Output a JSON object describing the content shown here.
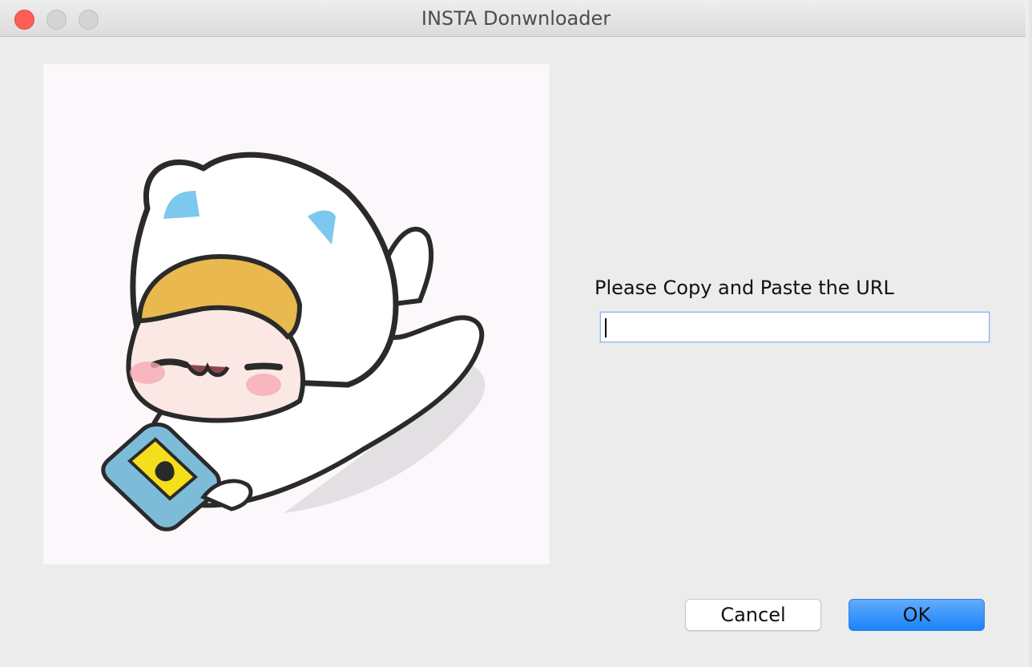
{
  "window": {
    "title": "INSTA Donwnloader",
    "controls": [
      "close",
      "minimize",
      "maximize"
    ]
  },
  "image": {
    "subject": "cartoon-character-in-white-cat-hood-holding-phone-icon"
  },
  "form": {
    "prompt": "Please Copy and Paste the URL",
    "url_value": "",
    "url_placeholder": ""
  },
  "buttons": {
    "cancel_label": "Cancel",
    "ok_label": "OK"
  },
  "colors": {
    "close": "#fc5f57",
    "ok_button": "#1a82fb",
    "focus_ring": "#8fb8ea"
  }
}
